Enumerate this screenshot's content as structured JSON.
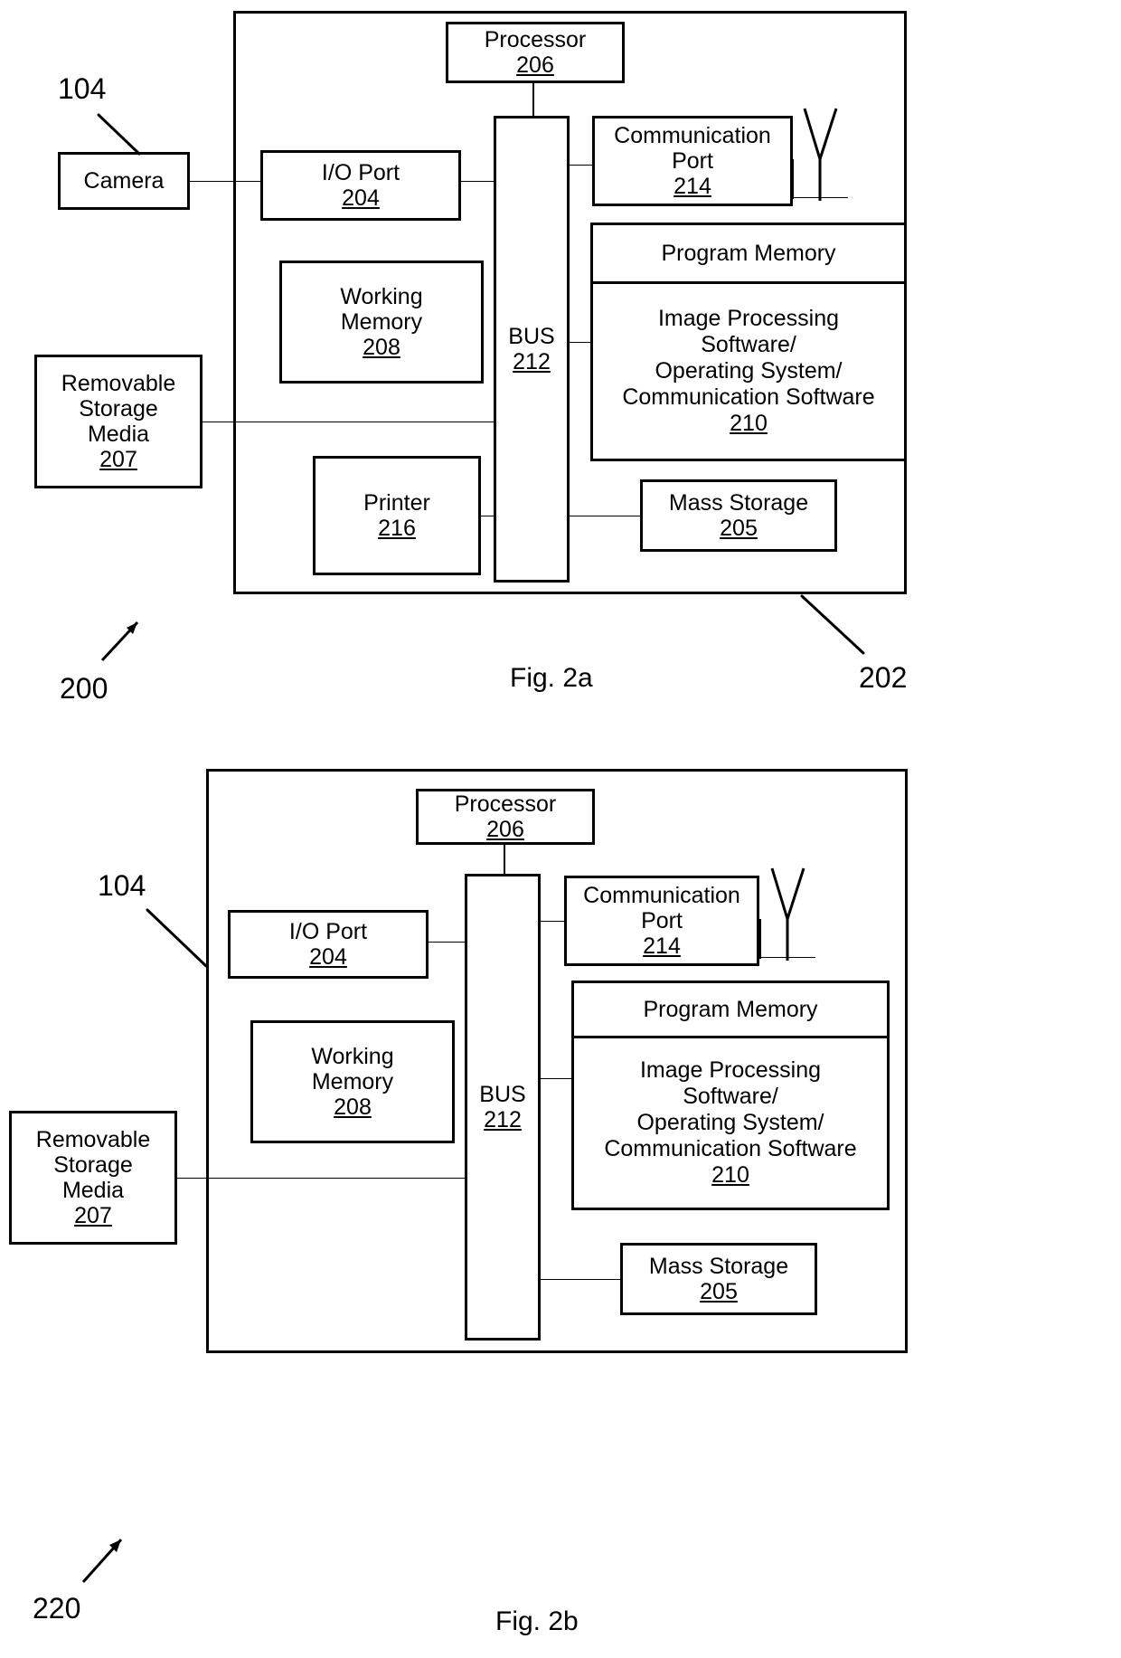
{
  "figures": [
    {
      "id": "fig2a",
      "caption": "Fig. 2a",
      "system_ref": "200",
      "enclosure_ref": "202",
      "camera_ref": "104",
      "blocks": {
        "camera": {
          "title": "Camera",
          "ref": ""
        },
        "io_port": {
          "title": "I/O Port",
          "ref": "204"
        },
        "processor": {
          "title": "Processor",
          "ref": "206"
        },
        "working_memory": {
          "title": "Working\nMemory",
          "ref": "208"
        },
        "removable": {
          "title": "Removable\nStorage\nMedia",
          "ref": "207"
        },
        "printer": {
          "title": "Printer",
          "ref": "216"
        },
        "bus": {
          "title": "BUS",
          "ref": "212"
        },
        "comm_port": {
          "title": "Communication\nPort",
          "ref": "214"
        },
        "mass_storage": {
          "title": "Mass Storage",
          "ref": "205"
        },
        "program_memory": {
          "header": "Program Memory",
          "body": "Image Processing\nSoftware/\nOperating System/\nCommunication Software",
          "ref": "210"
        }
      },
      "antenna": "antenna-symbol"
    },
    {
      "id": "fig2b",
      "caption": "Fig. 2b",
      "system_ref": "220",
      "camera_ref": "104",
      "blocks": {
        "io_port": {
          "title": "I/O Port",
          "ref": "204"
        },
        "processor": {
          "title": "Processor",
          "ref": "206"
        },
        "working_memory": {
          "title": "Working\nMemory",
          "ref": "208"
        },
        "removable": {
          "title": "Removable\nStorage\nMedia",
          "ref": "207"
        },
        "bus": {
          "title": "BUS",
          "ref": "212"
        },
        "comm_port": {
          "title": "Communication\nPort",
          "ref": "214"
        },
        "mass_storage": {
          "title": "Mass Storage",
          "ref": "205"
        },
        "program_memory": {
          "header": "Program Memory",
          "body": "Image Processing\nSoftware/\nOperating System/\nCommunication Software",
          "ref": "210"
        }
      },
      "antenna": "antenna-symbol"
    }
  ],
  "colors": {
    "ink": "#000000",
    "paper": "#ffffff"
  }
}
